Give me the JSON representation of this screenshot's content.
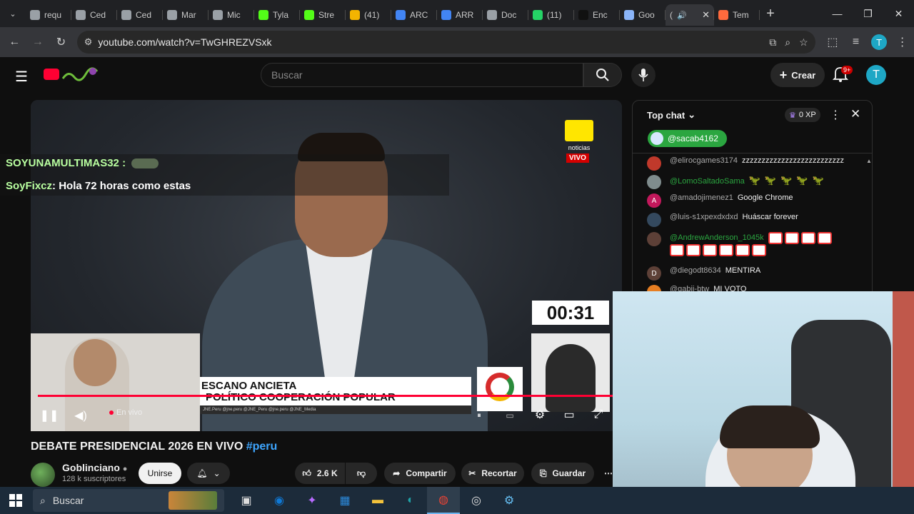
{
  "browser": {
    "tabs": [
      {
        "title": "requ",
        "favicon": "globe-icon",
        "color": "#9aa0a6"
      },
      {
        "title": "Ced",
        "favicon": "globe-icon",
        "color": "#9aa0a6"
      },
      {
        "title": "Ced",
        "favicon": "globe-icon",
        "color": "#9aa0a6"
      },
      {
        "title": "Mar",
        "favicon": "globe-icon",
        "color": "#9aa0a6"
      },
      {
        "title": "Mic",
        "favicon": "globe-icon",
        "color": "#9aa0a6"
      },
      {
        "title": "Tyla",
        "favicon": "kick-icon",
        "color": "#53fc18"
      },
      {
        "title": "Stre",
        "favicon": "kick-icon",
        "color": "#53fc18"
      },
      {
        "title": "(41)",
        "favicon": "app-icon",
        "color": "#f4b400"
      },
      {
        "title": "ARC",
        "favicon": "doc-icon",
        "color": "#4285f4"
      },
      {
        "title": "ARR",
        "favicon": "doc-icon",
        "color": "#4285f4"
      },
      {
        "title": "Doc",
        "favicon": "globe-icon",
        "color": "#9aa0a6"
      },
      {
        "title": "(11)",
        "favicon": "chat-icon",
        "color": "#25d366"
      },
      {
        "title": "Enc",
        "favicon": "tiktok-icon",
        "color": "#111111"
      },
      {
        "title": "Goo",
        "favicon": "gemini-icon",
        "color": "#8ab4f8"
      }
    ],
    "active_tab": {
      "title": "(",
      "audio": "speaker-icon",
      "close": "✕"
    },
    "after_tab": {
      "title": "Tem",
      "favicon": "app-icon",
      "color": "#ff6a3d"
    },
    "new_tab": "+",
    "url": "youtube.com/watch?v=TwGHREZVSxk",
    "profile_letter": "T",
    "window_controls": {
      "minimize": "—",
      "restore": "❐",
      "close": "✕"
    }
  },
  "youtube": {
    "search_placeholder": "Buscar",
    "create_label": "Crear",
    "notif_count": "9+",
    "avatar_letter": "T"
  },
  "video": {
    "overlay_chat": [
      {
        "name": "SOYUNAMULTIMAS32 :",
        "text": ""
      },
      {
        "name": "SoyFixcz",
        "text": ": Hola 72 horas como estas"
      }
    ],
    "broadcaster_logo_text": "noticias",
    "live_badge": "VIVO",
    "timer": "00:31",
    "lower_third_line1": "ESCANO ANCIETA",
    "lower_third_line2": "POLÍTICO COOPERACIÓN POPULAR",
    "lower_strip": "JNE.Peru   @jne.peru   @JNE_Peru   @jne.peru   @JNE_Media",
    "live_label": "En vivo",
    "progress": 1.0
  },
  "meta": {
    "title": "DEBATE PRESIDENCIAL 2026 EN VIVO",
    "hashtag": "#peru",
    "channel_name": "Goblinciano",
    "channel_subs": "128 k suscriptores",
    "join_label": "Unirse",
    "likes": "2.6 K",
    "share_label": "Compartir",
    "clip_label": "Recortar",
    "save_label": "Guardar"
  },
  "chat": {
    "header_label": "Top chat",
    "xp_label": "0 XP",
    "pinned_user": "@sacab4162",
    "messages": [
      {
        "author": "@elirocgames3174",
        "text": "zzzzzzzzzzzzzzzzzzzzzzzzzz",
        "avatar_color": "#c0392b",
        "mod": false
      },
      {
        "author": "@LomoSaltadoSama",
        "text": "",
        "avatar_color": "#7f8c8d",
        "mod": true,
        "dinos": 5
      },
      {
        "author": "@amadojimenez1",
        "text": "Google Chrome",
        "avatar_color": "#c2185b",
        "avatar_letter": "A",
        "mod": false
      },
      {
        "author": "@luis-s1xpexdxdxd",
        "text": "Huáscar forever",
        "avatar_color": "#34495e",
        "mod": false
      },
      {
        "author": "@AndrewAnderson_1045k",
        "text": "",
        "avatar_color": "#5d4037",
        "mod": true,
        "tickets": 10
      },
      {
        "author": "@diegodt8634",
        "text": "MENTIRA",
        "avatar_color": "#5d4037",
        "avatar_letter": "D",
        "mod": false
      },
      {
        "author": "@gabii-btw",
        "text": "MI VOTO",
        "avatar_color": "#e67e22",
        "mod": false
      }
    ]
  },
  "taskbar": {
    "search_label": "Buscar",
    "apps": [
      "task-view-icon",
      "outlook-icon",
      "copilot-icon",
      "store-icon",
      "files-icon",
      "edge-icon",
      "chrome-icon",
      "obs-icon",
      "steam-icon"
    ]
  }
}
